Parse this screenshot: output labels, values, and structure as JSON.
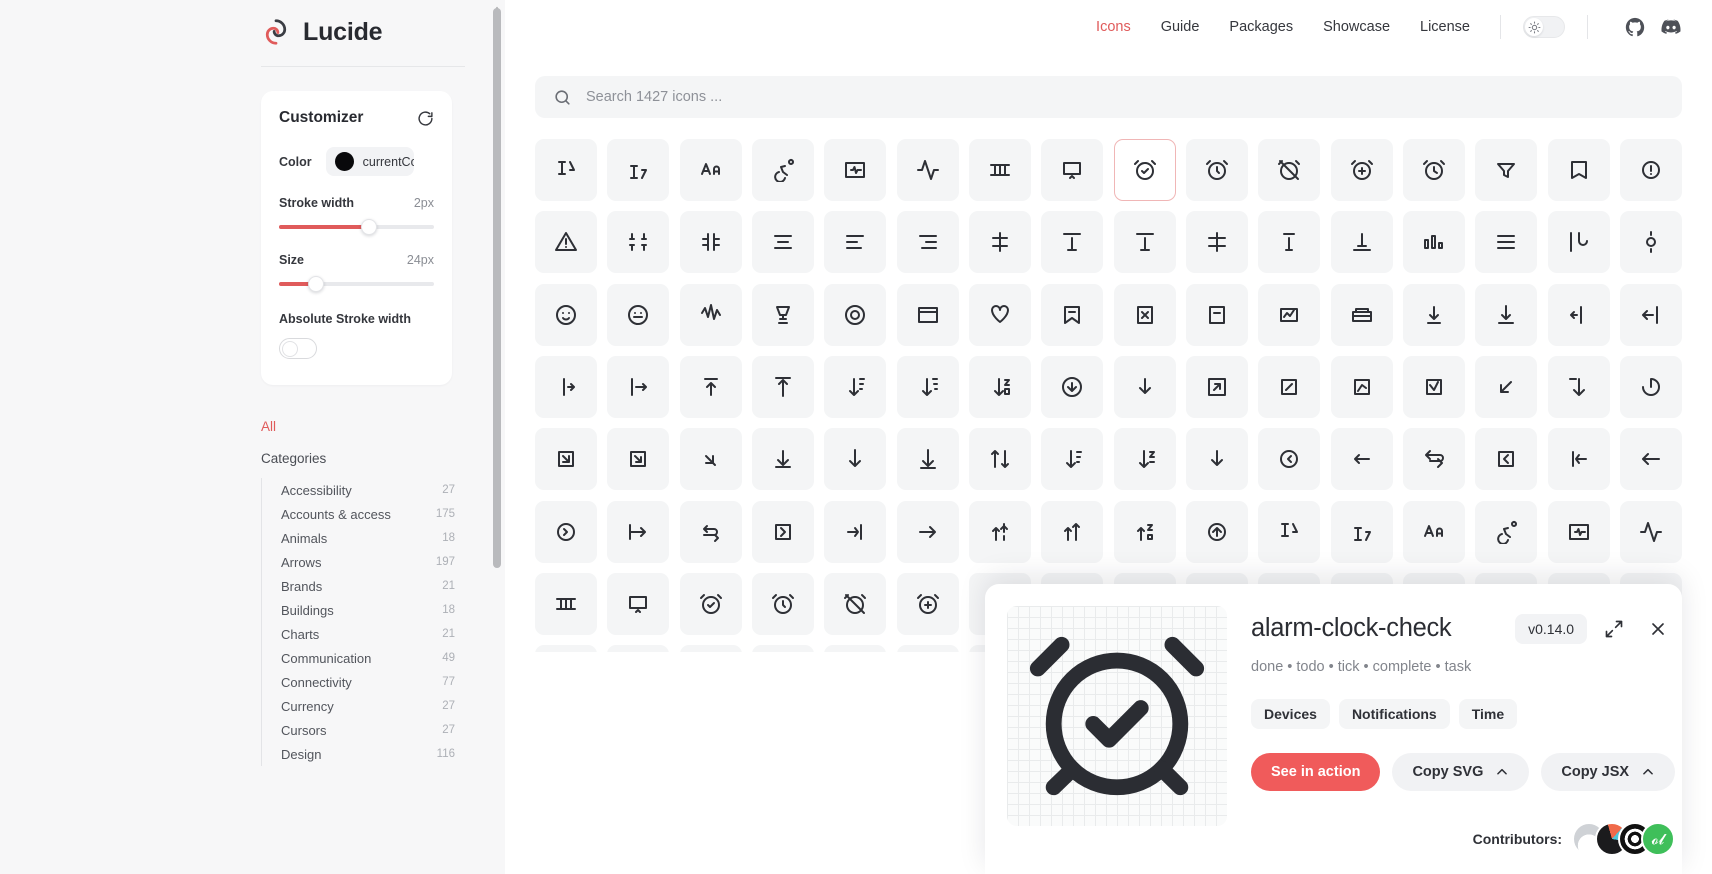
{
  "brand": {
    "name": "Lucide",
    "logo_icon": "lucide-logo-icon"
  },
  "customizer": {
    "title": "Customizer",
    "reset_icon": "refresh-icon",
    "color_label": "Color",
    "color_value": "currentColor",
    "color_swatch_hex": "#09090b",
    "stroke_label": "Stroke width",
    "stroke_value": "2px",
    "stroke_pct": 58,
    "size_label": "Size",
    "size_value": "24px",
    "size_pct": 24,
    "absolute_label": "Absolute Stroke width",
    "absolute_on": false
  },
  "sidebar": {
    "all_label": "All",
    "categories_label": "Categories",
    "categories": [
      {
        "label": "Accessibility",
        "count": "27"
      },
      {
        "label": "Accounts & access",
        "count": "175"
      },
      {
        "label": "Animals",
        "count": "18"
      },
      {
        "label": "Arrows",
        "count": "197"
      },
      {
        "label": "Brands",
        "count": "21"
      },
      {
        "label": "Buildings",
        "count": "18"
      },
      {
        "label": "Charts",
        "count": "21"
      },
      {
        "label": "Communication",
        "count": "49"
      },
      {
        "label": "Connectivity",
        "count": "77"
      },
      {
        "label": "Currency",
        "count": "27"
      },
      {
        "label": "Cursors",
        "count": "27"
      },
      {
        "label": "Design",
        "count": "116"
      }
    ]
  },
  "topnav": {
    "links": [
      {
        "label": "Icons",
        "active": true
      },
      {
        "label": "Guide",
        "active": false
      },
      {
        "label": "Packages",
        "active": false
      },
      {
        "label": "Showcase",
        "active": false
      },
      {
        "label": "License",
        "active": false
      }
    ],
    "theme_toggle_icon": "sun-icon",
    "github_icon": "github-icon",
    "discord_icon": "discord-icon"
  },
  "search": {
    "placeholder": "Search 1427 icons ...",
    "value": "",
    "icon": "search-icon"
  },
  "grid": {
    "selected_index": 8,
    "selected_name": "alarm-clock-check"
  },
  "detail": {
    "name": "alarm-clock-check",
    "tags": "done • todo • tick • complete • task",
    "categories": [
      "Devices",
      "Notifications",
      "Time"
    ],
    "version": "v0.14.0",
    "expand_icon": "maximize-icon",
    "close_icon": "close-icon",
    "primary_button": "See in action",
    "copy_svg_button": "Copy SVG",
    "copy_jsx_button": "Copy JSX",
    "chevron_icon": "chevron-up-icon",
    "contributors_label": "Contributors:",
    "accent_hex": "#f05b5b"
  }
}
